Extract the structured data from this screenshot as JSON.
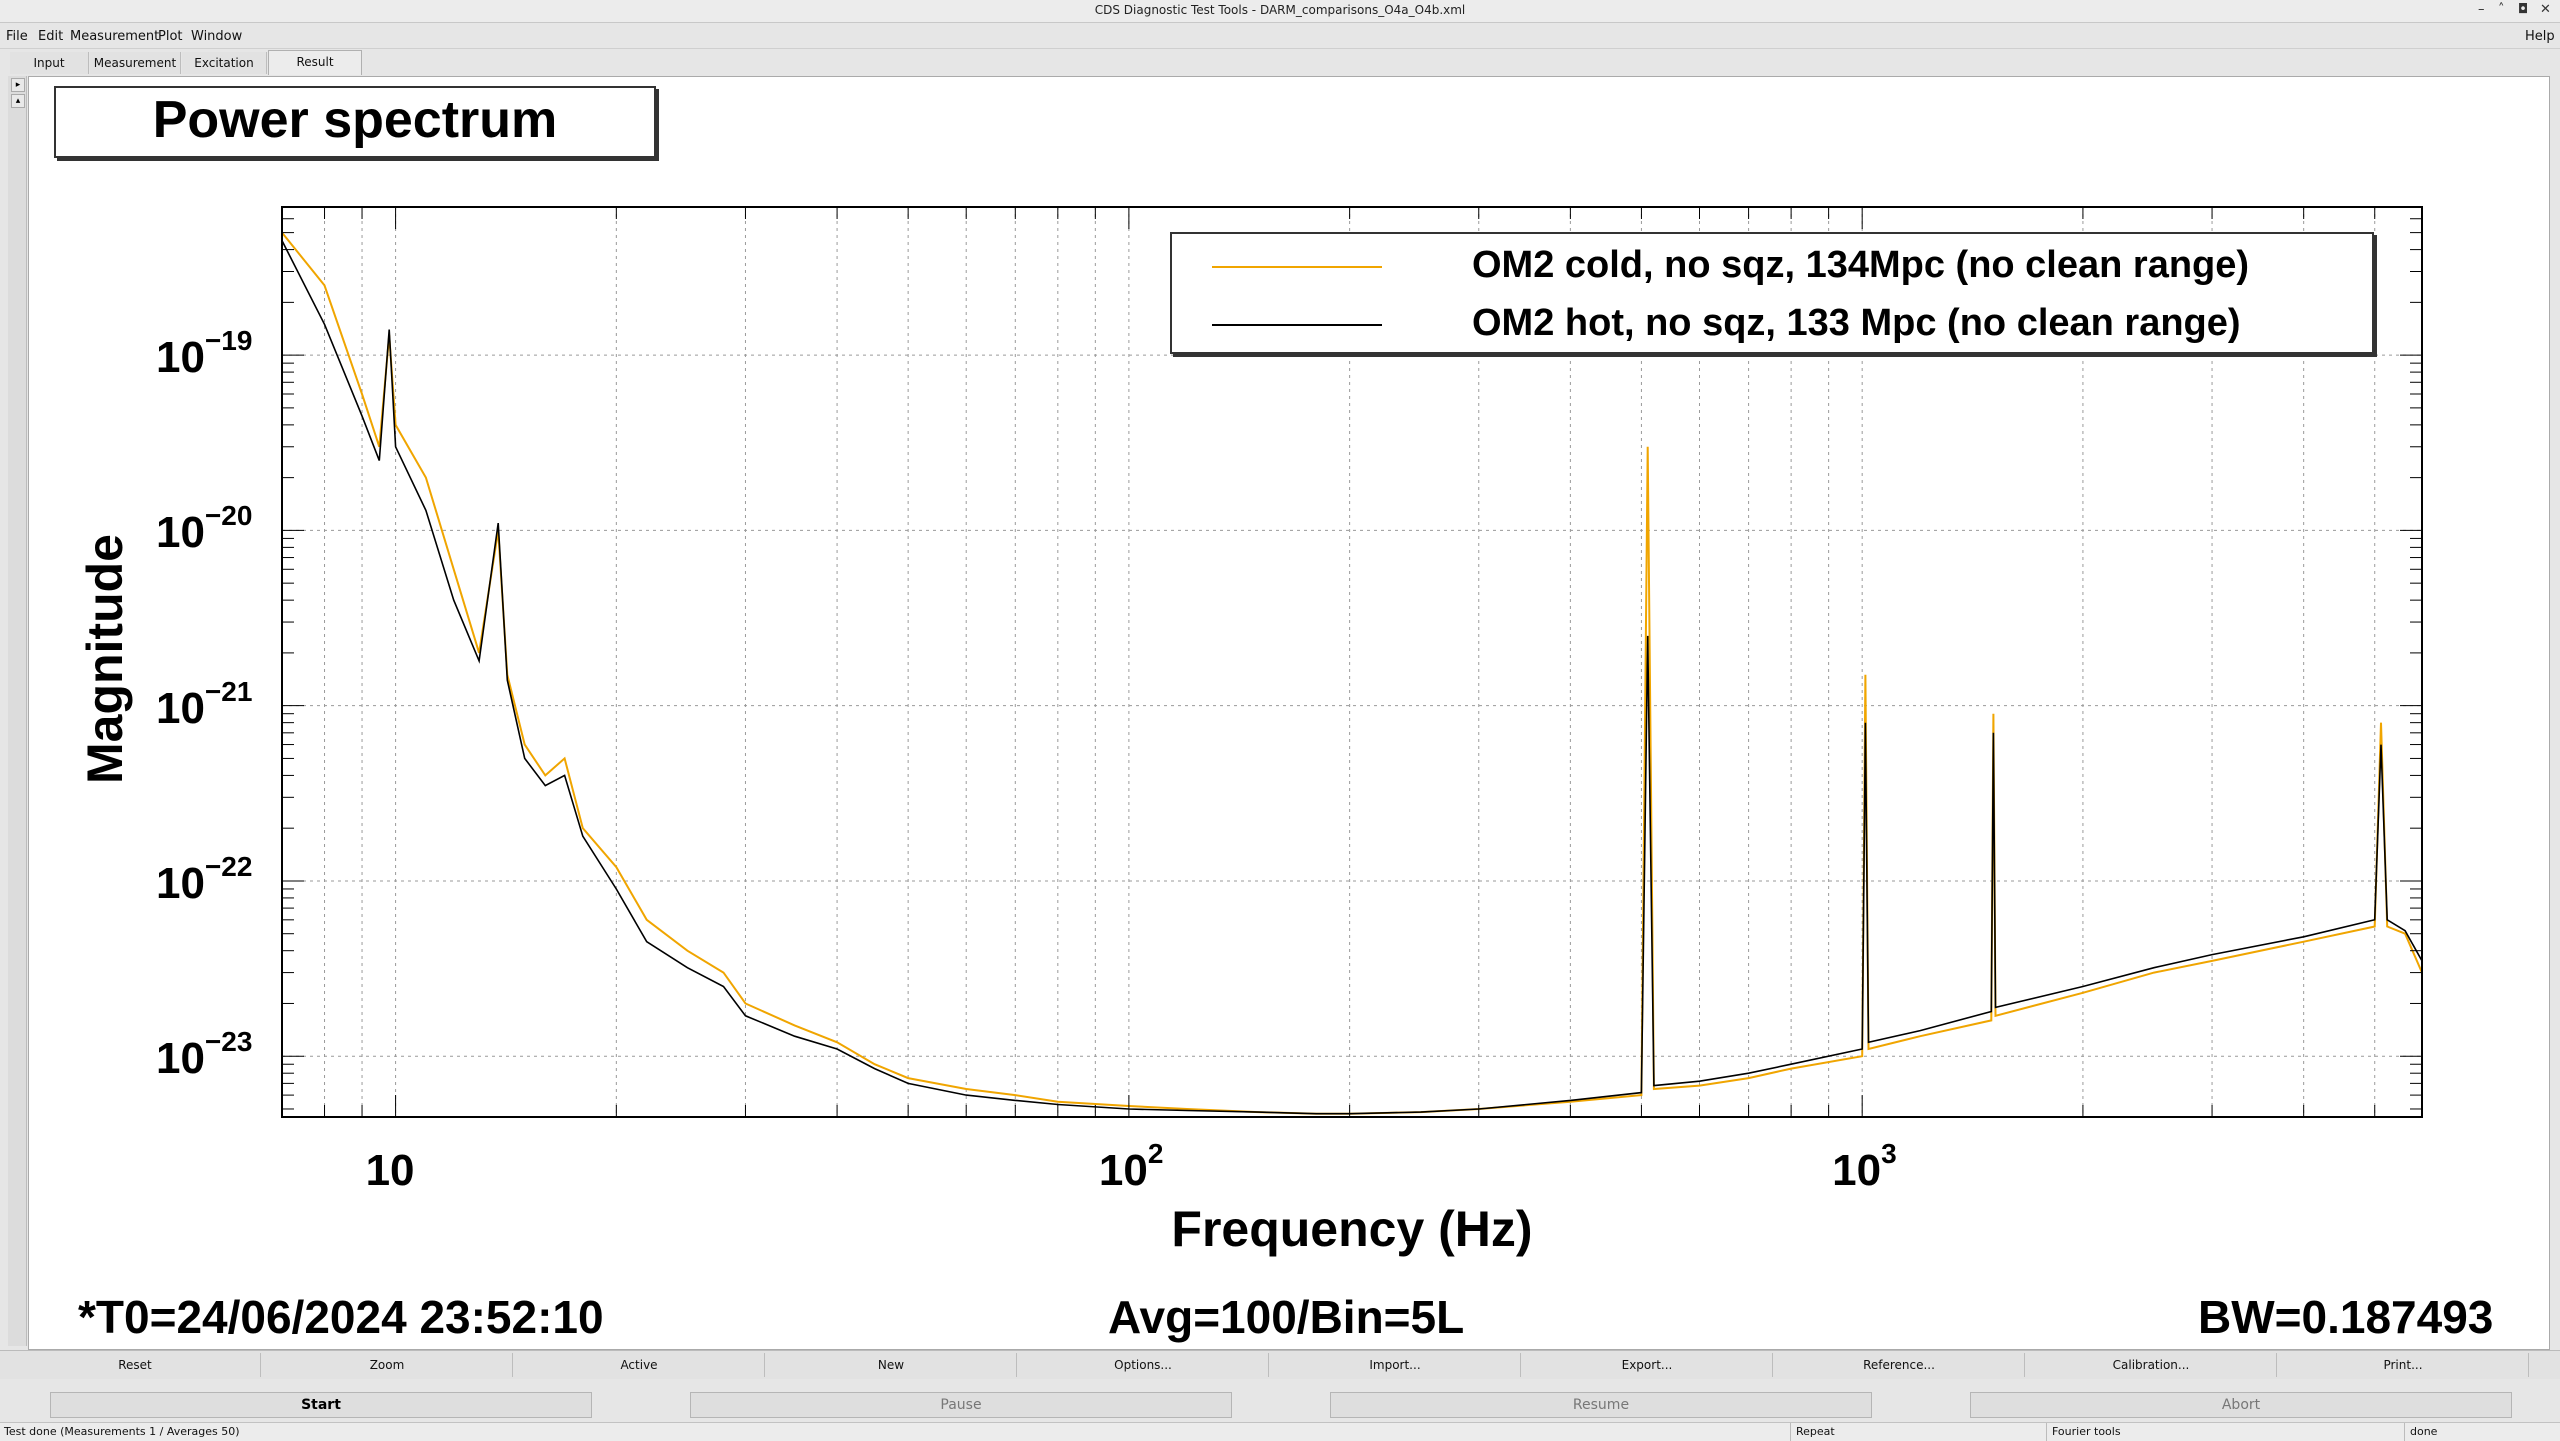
{
  "window": {
    "title": "CDS Diagnostic Test Tools - DARM_comparisons_O4a_O4b.xml"
  },
  "menu": {
    "file": "File",
    "edit": "Edit",
    "measurement": "Measurement",
    "plot": "Plot",
    "window": "Window",
    "help": "Help"
  },
  "tabs": [
    "Input",
    "Measurement",
    "Excitation",
    "Result"
  ],
  "plot": {
    "title": "Power spectrum",
    "ylabel": "Magnitude",
    "xlabel": "Frequency (Hz)"
  },
  "chart_data": {
    "type": "line",
    "title": "Power spectrum",
    "xlabel": "Frequency (Hz)",
    "ylabel": "Magnitude",
    "xscale": "log",
    "yscale": "log",
    "xlim": [
      7,
      5800
    ],
    "ylim": [
      4.5e-24,
      7e-19
    ],
    "grid": true,
    "legend_position": "top-right",
    "x_ticks": [
      {
        "base": "10",
        "exp": ""
      },
      {
        "base": "10",
        "exp": "2"
      },
      {
        "base": "10",
        "exp": "3"
      }
    ],
    "y_ticks": [
      {
        "base": "10",
        "exp": "−19"
      },
      {
        "base": "10",
        "exp": "−20"
      },
      {
        "base": "10",
        "exp": "−21"
      },
      {
        "base": "10",
        "exp": "−22"
      },
      {
        "base": "10",
        "exp": "−23"
      }
    ],
    "series": [
      {
        "name": "OM2 cold, no sqz, 134Mpc (no clean range)",
        "color": "#f0a500",
        "x": [
          7,
          8,
          9,
          9.5,
          9.8,
          10,
          11,
          12,
          13,
          13.8,
          14.2,
          15,
          16,
          17,
          18,
          20,
          22,
          25,
          28,
          30,
          35,
          40,
          45,
          50,
          60,
          70,
          80,
          100,
          120,
          150,
          180,
          200,
          250,
          300,
          400,
          500,
          510,
          520,
          600,
          700,
          800,
          1000,
          1010,
          1020,
          1200,
          1500,
          1510,
          1520,
          2000,
          2500,
          3000,
          4000,
          5000,
          5100,
          5200,
          5500,
          5800
        ],
        "y": [
          5e-19,
          2.5e-19,
          6e-20,
          3e-20,
          1.3e-19,
          4e-20,
          2e-20,
          6e-21,
          2e-21,
          1e-20,
          1.5e-21,
          6e-22,
          4e-22,
          5e-22,
          2e-22,
          1.2e-22,
          6e-23,
          4e-23,
          3e-23,
          2e-23,
          1.5e-23,
          1.2e-23,
          9e-24,
          7.5e-24,
          6.5e-24,
          6e-24,
          5.5e-24,
          5.2e-24,
          5e-24,
          4.8e-24,
          4.7e-24,
          4.7e-24,
          4.8e-24,
          5e-24,
          5.5e-24,
          6e-24,
          3e-20,
          6.5e-24,
          6.8e-24,
          7.5e-24,
          8.5e-24,
          1e-23,
          1.5e-21,
          1.1e-23,
          1.3e-23,
          1.6e-23,
          9e-22,
          1.7e-23,
          2.3e-23,
          3e-23,
          3.5e-23,
          4.5e-23,
          5.5e-23,
          8e-22,
          5.5e-23,
          5e-23,
          3e-23
        ]
      },
      {
        "name": "OM2 hot, no sqz, 133 Mpc (no clean range)",
        "color": "#000000",
        "x": [
          7,
          8,
          9,
          9.5,
          9.8,
          10,
          11,
          12,
          13,
          13.8,
          14.2,
          15,
          16,
          17,
          18,
          20,
          22,
          25,
          28,
          30,
          35,
          40,
          45,
          50,
          60,
          70,
          80,
          100,
          120,
          150,
          180,
          200,
          250,
          300,
          400,
          500,
          510,
          520,
          600,
          700,
          800,
          1000,
          1010,
          1020,
          1200,
          1500,
          1510,
          1520,
          2000,
          2500,
          3000,
          4000,
          5000,
          5100,
          5200,
          5500,
          5800
        ],
        "y": [
          4.5e-19,
          1.5e-19,
          4.5e-20,
          2.5e-20,
          1.4e-19,
          3e-20,
          1.3e-20,
          4e-21,
          1.8e-21,
          1.1e-20,
          1.4e-21,
          5e-22,
          3.5e-22,
          4e-22,
          1.8e-22,
          9e-23,
          4.5e-23,
          3.2e-23,
          2.5e-23,
          1.7e-23,
          1.3e-23,
          1.1e-23,
          8.5e-24,
          7e-24,
          6e-24,
          5.6e-24,
          5.3e-24,
          5e-24,
          4.9e-24,
          4.8e-24,
          4.7e-24,
          4.7e-24,
          4.8e-24,
          5e-24,
          5.6e-24,
          6.2e-24,
          2.5e-21,
          6.8e-24,
          7.2e-24,
          8e-24,
          9e-24,
          1.1e-23,
          8e-22,
          1.2e-23,
          1.4e-23,
          1.8e-23,
          7e-22,
          1.9e-23,
          2.5e-23,
          3.2e-23,
          3.8e-23,
          4.8e-23,
          6e-23,
          6e-22,
          6e-23,
          5.2e-23,
          3.5e-23
        ]
      }
    ]
  },
  "footer": {
    "t0": "*T0=24/06/2024 23:52:10",
    "avg": "Avg=100/Bin=5L",
    "bw": "BW=0.187493"
  },
  "buttons": [
    "Reset",
    "Zoom",
    "Active",
    "New",
    "Options...",
    "Import...",
    "Export...",
    "Reference...",
    "Calibration...",
    "Print..."
  ],
  "controls": [
    "Start",
    "Pause",
    "Resume",
    "Abort"
  ],
  "status": {
    "main": "Test done (Measurements 1 / Averages 50)",
    "repeat": "Repeat",
    "fourier": "Fourier tools",
    "done": "done"
  }
}
